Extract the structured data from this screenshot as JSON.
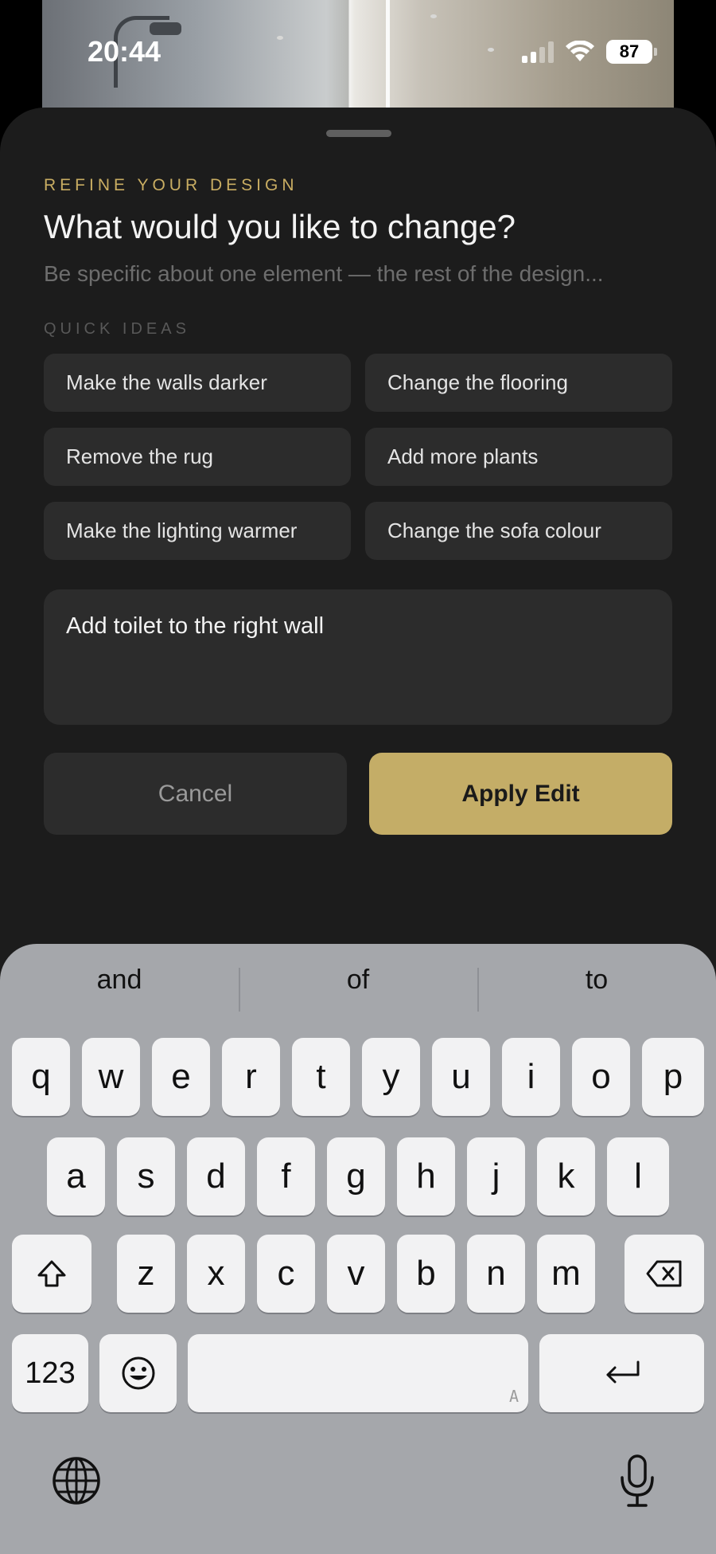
{
  "status_bar": {
    "time": "20:44",
    "battery": "87"
  },
  "sheet": {
    "eyebrow": "REFINE YOUR DESIGN",
    "title": "What would you like to change?",
    "subtitle": "Be specific about one element — the rest of the design...",
    "quick_ideas_label": "QUICK IDEAS",
    "quick_ideas": [
      "Make the walls darker",
      "Change the flooring",
      "Remove the rug",
      "Add more plants",
      "Make the lighting warmer",
      "Change the sofa colour"
    ],
    "input_value": "Add toilet to the right wall",
    "cancel_label": "Cancel",
    "apply_label": "Apply Edit"
  },
  "keyboard": {
    "suggestions": [
      "and",
      "of",
      "to"
    ],
    "row1": [
      "q",
      "w",
      "e",
      "r",
      "t",
      "y",
      "u",
      "i",
      "o",
      "p"
    ],
    "row2": [
      "a",
      "s",
      "d",
      "f",
      "g",
      "h",
      "j",
      "k",
      "l"
    ],
    "row3": [
      "z",
      "x",
      "c",
      "v",
      "b",
      "n",
      "m"
    ],
    "numbers_label": "123",
    "space_hint": "A"
  },
  "colors": {
    "accent": "#c4ad67",
    "sheet_bg": "#1c1c1c",
    "chip_bg": "#2c2c2c",
    "keyboard_bg": "#a5a7ab"
  }
}
